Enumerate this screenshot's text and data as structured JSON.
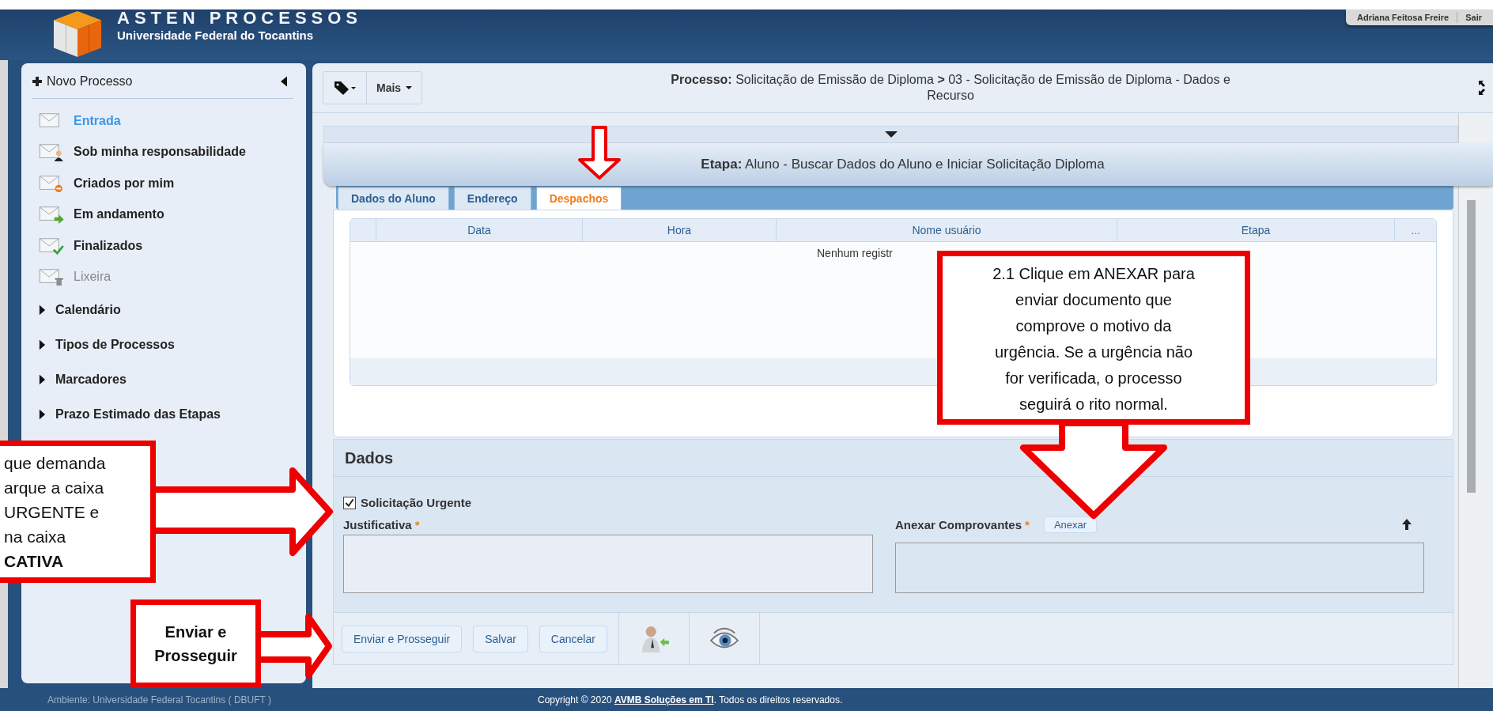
{
  "header": {
    "title": "ASTEN PROCESSOS",
    "subtitle": "Universidade Federal do Tocantins",
    "user": "Adriana Feitosa Freire",
    "logout": "Sair"
  },
  "sidebar": {
    "new_process": "Novo Processo",
    "folders": [
      {
        "label": "Entrada",
        "kind": "inbox",
        "selected": true,
        "disabled": false
      },
      {
        "label": "Sob minha responsabilidade",
        "kind": "person",
        "selected": false,
        "disabled": false
      },
      {
        "label": "Criados por mim",
        "kind": "created",
        "selected": false,
        "disabled": false
      },
      {
        "label": "Em andamento",
        "kind": "progress",
        "selected": false,
        "disabled": false
      },
      {
        "label": "Finalizados",
        "kind": "done",
        "selected": false,
        "disabled": false
      },
      {
        "label": "Lixeira",
        "kind": "trash",
        "selected": false,
        "disabled": true
      }
    ],
    "groups": [
      {
        "label": "Calendário",
        "expanded": false
      },
      {
        "label": "Tipos de Processos",
        "expanded": false
      },
      {
        "label": "Marcadores",
        "expanded": false
      },
      {
        "label": "Prazo Estimado das Etapas",
        "expanded": false
      }
    ]
  },
  "toolbar": {
    "more": "Mais"
  },
  "breadcrumb": "**Processo:**  Solicitação de Emissão de Diploma  **>**  03 - Solicitação de Emissão de Diploma - Dados e Recurso",
  "stage": "**Etapa:** Aluno - Buscar Dados do Aluno e Iniciar Solicitação Diploma",
  "tabs": [
    {
      "label": "Dados do Aluno",
      "selected": false
    },
    {
      "label": "Endereço",
      "selected": false
    },
    {
      "label": "Despachos",
      "selected": true
    }
  ],
  "table": {
    "columns": [
      "Data",
      "Hora",
      "Nome usuário",
      "Etapa",
      "..."
    ],
    "empty_text": "Nenhum registr"
  },
  "dados": {
    "title": "Dados",
    "urgent": {
      "label": "Solicitação Urgente",
      "checked": true
    },
    "justificativa": {
      "label": "Justificativa",
      "mark": "*"
    },
    "anexar": {
      "label": "Anexar Comprovantes",
      "mark": "*",
      "button": "Anexar"
    }
  },
  "actions": [
    "Enviar e Prosseguir",
    "Salvar",
    "Cancelar"
  ],
  "footer": {
    "environment": "Ambiente: Universidade Federal Tocantins ( DBUFT )",
    "before": "Copyright © 2020 ",
    "link": "AVMB Soluções em TI",
    "after": ". Todos os direitos reservados."
  },
  "annotations": {
    "urgent_note": [
      "que demanda",
      "arque a caixa",
      "URGENTE  e",
      "na  caixa",
      "**CATIVA**"
    ],
    "submit_note": [
      "Enviar e",
      "Prosseguir"
    ],
    "attach_note": [
      "2.1 Clique em ANEXAR para",
      "enviar documento que",
      "comprove o motivo da",
      "urgência.  Se a urgência não",
      "for verificada, o processo",
      "seguirá o rito normal."
    ]
  }
}
